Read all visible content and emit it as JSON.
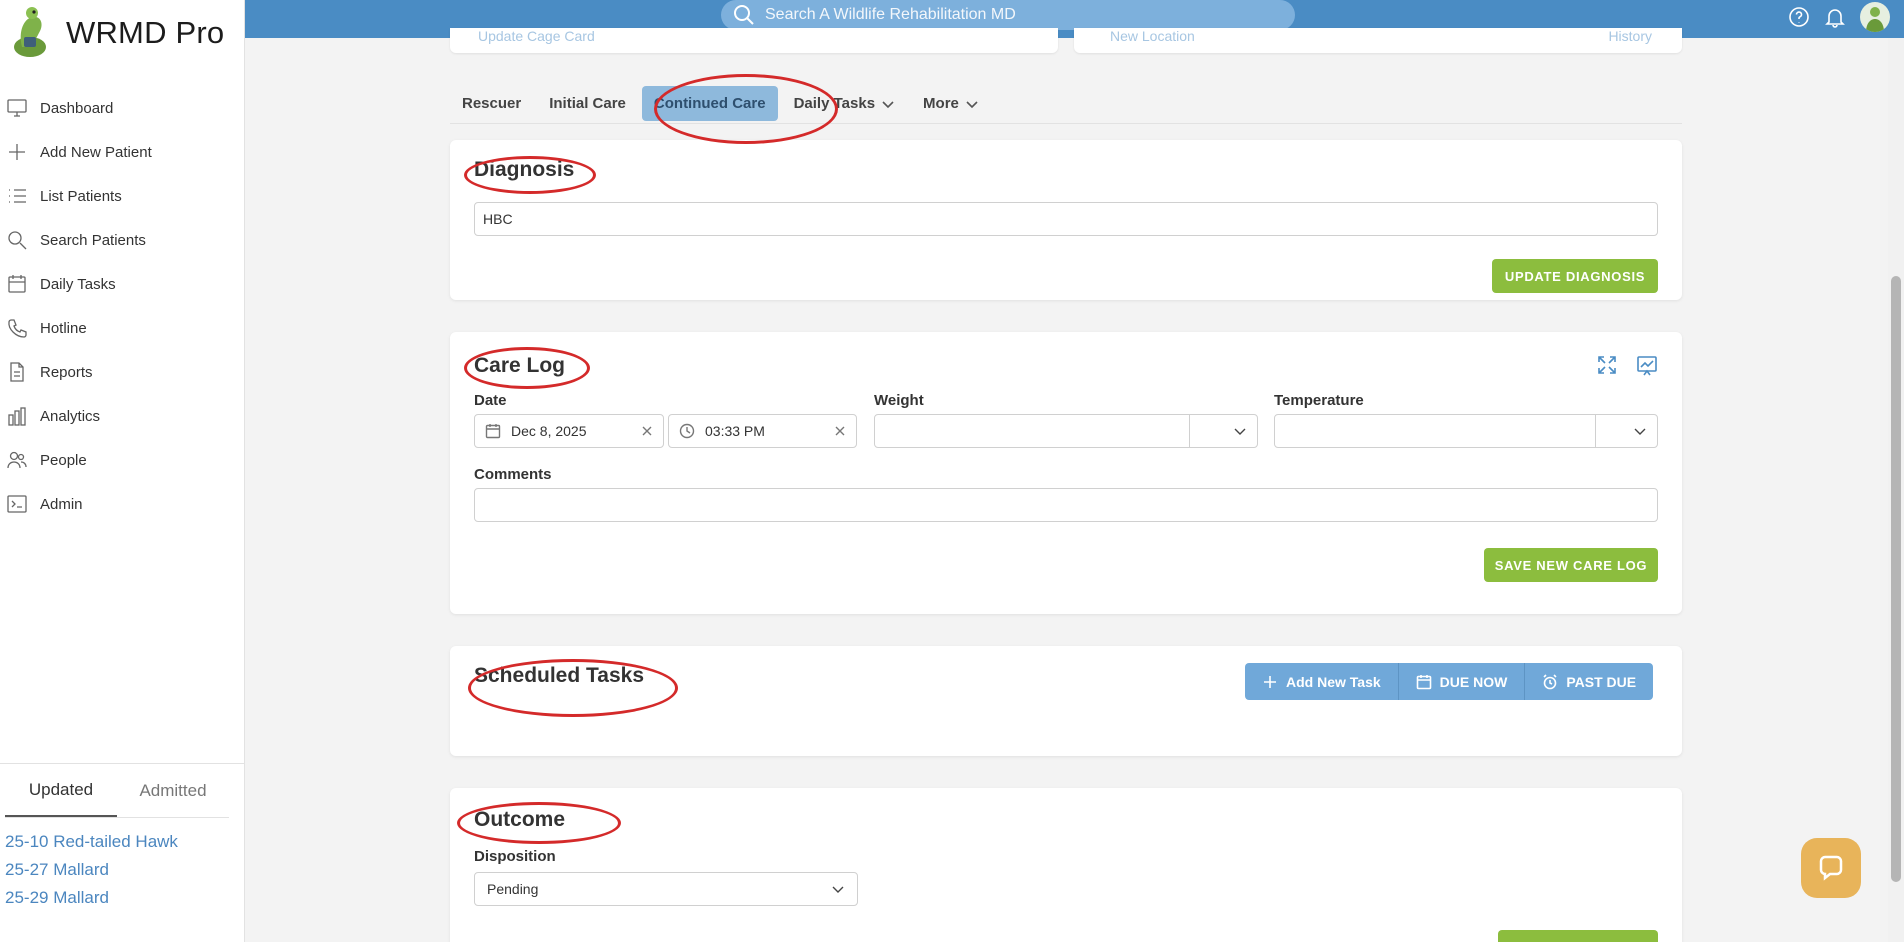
{
  "app": {
    "name": "WRMD Pro"
  },
  "nav": [
    {
      "label": "Dashboard",
      "icon": "monitor-icon"
    },
    {
      "label": "Add New Patient",
      "icon": "plus-icon"
    },
    {
      "label": "List Patients",
      "icon": "list-icon"
    },
    {
      "label": "Search Patients",
      "icon": "search-icon"
    },
    {
      "label": "Daily Tasks",
      "icon": "calendar-icon"
    },
    {
      "label": "Hotline",
      "icon": "phone-icon"
    },
    {
      "label": "Reports",
      "icon": "document-icon"
    },
    {
      "label": "Analytics",
      "icon": "bar-chart-icon"
    },
    {
      "label": "People",
      "icon": "people-icon"
    },
    {
      "label": "Admin",
      "icon": "terminal-icon"
    }
  ],
  "sidebar_tabs": {
    "updated": "Updated",
    "admitted": "Admitted"
  },
  "recent_patients": [
    "25-10 Red-tailed Hawk",
    "25-27 Mallard",
    "25-29 Mallard"
  ],
  "topbar": {
    "search_placeholder": "Search A Wildlife Rehabilitation MD"
  },
  "top_cards": {
    "left": "Update Cage Card",
    "middle": "New Location",
    "right": "History"
  },
  "tabs": {
    "rescuer": "Rescuer",
    "initial_care": "Initial Care",
    "continued_care": "Continued Care",
    "daily_tasks": "Daily Tasks",
    "more": "More"
  },
  "diagnosis": {
    "title": "Diagnosis",
    "value": "HBC",
    "button": "UPDATE DIAGNOSIS"
  },
  "care_log": {
    "title": "Care Log",
    "date_label": "Date",
    "date_value": "Dec 8, 2025",
    "time_value": "03:33 PM",
    "weight_label": "Weight",
    "temperature_label": "Temperature",
    "comments_label": "Comments",
    "button": "SAVE NEW CARE LOG"
  },
  "scheduled_tasks": {
    "title": "Scheduled Tasks",
    "add": "Add New Task",
    "due_now": "DUE NOW",
    "past_due": "PAST DUE"
  },
  "outcome": {
    "title": "Outcome",
    "disposition_label": "Disposition",
    "disposition_value": "Pending"
  },
  "colors": {
    "topbar": "#4a8cc4",
    "accent_green": "#8cbd3e",
    "annotation_red": "#d42a2a",
    "link_blue": "#4b86bf"
  }
}
